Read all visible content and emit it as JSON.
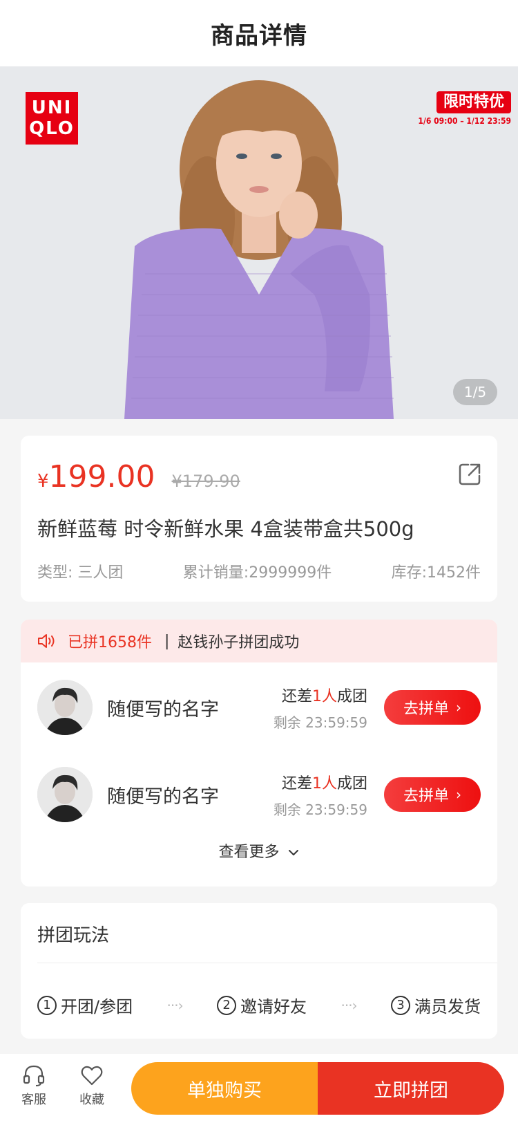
{
  "header": {
    "title": "商品详情"
  },
  "banner": {
    "logo_line1": "UNI",
    "logo_line2": "QLO",
    "promo_badge": "限时特优",
    "promo_time": "1/6 09:00 – 1/12 23:59",
    "page_indicator": "1/5"
  },
  "product": {
    "price_symbol": "¥",
    "price": "199.00",
    "original_price": "¥179.90",
    "title": "新鲜蓝莓 时令新鲜水果 4盒装带盒共500g",
    "type": "类型: 三人团",
    "sales": "累计销量:2999999件",
    "stock": "库存:1452件"
  },
  "group": {
    "notice_count": "已拼1658件",
    "notice_sep": "|",
    "notice_text": "赵钱孙子拼团成功",
    "rows": [
      {
        "name": "随便写的名字",
        "status_prefix": "还差",
        "status_count": "1人",
        "status_suffix": "成团",
        "remaining": "剩余 23:59:59",
        "button": "去拼单"
      },
      {
        "name": "随便写的名字",
        "status_prefix": "还差",
        "status_count": "1人",
        "status_suffix": "成团",
        "remaining": "剩余 23:59:59",
        "button": "去拼单"
      }
    ],
    "see_more": "查看更多"
  },
  "rules": {
    "title": "拼团玩法",
    "steps": [
      {
        "num": "1",
        "label": "开团/参团"
      },
      {
        "num": "2",
        "label": "邀请好友"
      },
      {
        "num": "3",
        "label": "满员发货"
      }
    ]
  },
  "bottom": {
    "service_label": "客服",
    "favorite_label": "收藏",
    "buy_single": "单独购买",
    "buy_group": "立即拼团"
  },
  "colors": {
    "accent_red": "#e93323",
    "accent_orange": "#fda31d",
    "notice_bg": "#fde9e9"
  }
}
